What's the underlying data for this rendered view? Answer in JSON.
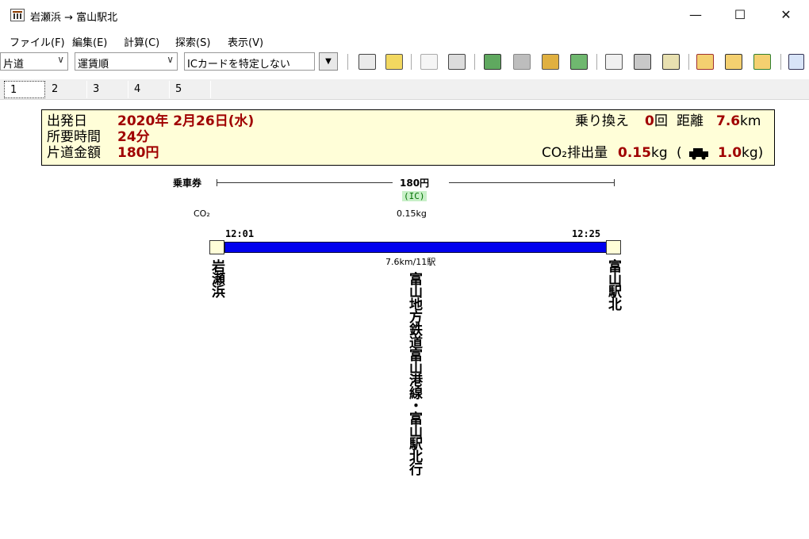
{
  "window": {
    "title": "岩瀬浜 → 富山駅北",
    "minimize_glyph": "—",
    "maximize_glyph": "☐",
    "close_glyph": "✕"
  },
  "menu": [
    "ファイル(F)",
    "編集(E)",
    "計算(C)",
    "探索(S)",
    "表示(V)"
  ],
  "toolbar": {
    "trip_type": "片道",
    "sort_order": "運賃順",
    "ic_card": "ICカードを特定しない",
    "dropdown_arrow": "∨",
    "drop_button": "▼",
    "icons": [
      "calendar-icon",
      "route-icon",
      "express-icon",
      "copy-icon",
      "train-icon",
      "ic-icon",
      "map-icon",
      "timetable-icon",
      "memo-icon",
      "print-icon",
      "window-icon",
      "prev-icon",
      "search-icon",
      "next-icon",
      "edit-icon"
    ]
  },
  "tabs": [
    "1",
    "2",
    "3",
    "4",
    "5"
  ],
  "summary": {
    "departure_label": "出発日",
    "departure_value": "2020年 2月26日(水)",
    "duration_label": "所要時間",
    "duration_value": "24分",
    "fare_label": "片道金額",
    "fare_value": "180円",
    "transfers_label": "乗り換え",
    "transfers_value": "0",
    "transfers_unit": "回",
    "distance_label": "距離",
    "distance_value": "7.6",
    "distance_unit": "km",
    "co2_label": "CO₂排出量",
    "co2_value": "0.15",
    "co2_unit": "kg",
    "car_open": "(",
    "car_value": "1.0",
    "car_unit": "kg)"
  },
  "route": {
    "ticket_label": "乗車券",
    "fare": "180円",
    "ic_label": "(IC)",
    "co2_label": "CO₂",
    "co2_value": "0.15kg",
    "dep_time": "12:01",
    "arr_time": "12:25",
    "distance": "7.6km/11駅",
    "from_station": "岩瀬浜",
    "to_station": "富山駅北",
    "line_name": "富山地方鉄道富山港線・富山駅北行",
    "line_color": "#0000ee"
  }
}
